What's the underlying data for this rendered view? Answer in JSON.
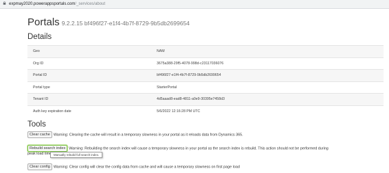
{
  "browser": {
    "url_host": "expmay2020.powerappsportals.com",
    "url_path": "/_services/about"
  },
  "page": {
    "title": "Portals",
    "version": "9.2.2.15 bf496f27-e1f4-4b7f-8729-9b5db2699654"
  },
  "details": {
    "heading": "Details",
    "rows": [
      {
        "label": "Geo",
        "value": "NAM"
      },
      {
        "label": "Org ID",
        "value": "3675a388-29f5-4078-998d-c23117036076"
      },
      {
        "label": "Portal ID",
        "value": "bf496f27-e1f4-4b7f-8729-9b5db2699654"
      },
      {
        "label": "Portal type",
        "value": "StarterPortal"
      },
      {
        "label": "Tenant ID",
        "value": "4d5aaad8-ead8-4811-a0e9-30395e7458d3"
      },
      {
        "label": "Auth key expiration date",
        "value": "5/6/2022 12:16:28 PM UTC"
      }
    ]
  },
  "tools": {
    "heading": "Tools",
    "clear_cache": {
      "button": "Clear cache",
      "warning": "Warning: Clearing the cache will result in a temporary slowness in your portal as it reloads data from Dynamics 365."
    },
    "rebuild_index": {
      "button": "Rebuild search index",
      "warning_line1": "Warning: Rebuilding the search index will cause a temporary slowness in your portal as the search index is rebuild. This action should not be performed during",
      "warning_line2": "peak load time.",
      "tooltip": "Manually rebuild full search index."
    },
    "clear_config": {
      "button": "Clear config",
      "warning": "Warning: Clear config will clear the config data from cache and will cause a temporary slowness on first page load"
    }
  },
  "colors": {
    "highlight_border": "#7ac143",
    "row_stripe": "#f6f6f6"
  }
}
